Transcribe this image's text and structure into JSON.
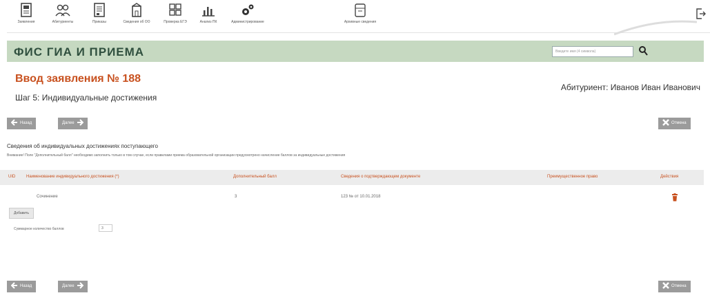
{
  "toolbar": {
    "items": [
      {
        "label": "Заявления",
        "icon": "document-icon"
      },
      {
        "label": "Абитуриенты",
        "icon": "users-icon"
      },
      {
        "label": "Приказы",
        "icon": "order-icon"
      },
      {
        "label": "Сведения об ОО",
        "icon": "building-icon"
      },
      {
        "label": "Проверка ЕГЭ",
        "icon": "grid-check-icon"
      },
      {
        "label": "Анализ ПК",
        "icon": "bar-chart-icon"
      },
      {
        "label": "Администрирование",
        "icon": "gears-icon"
      },
      {
        "label": "Архивные сведения",
        "icon": "archive-icon"
      }
    ]
  },
  "header": {
    "brand": "ФИС ГИА И ПРИЕМА",
    "search_placeholder": "Введите имя (4 символа)"
  },
  "page": {
    "title": "Ввод заявления № 188",
    "step": "Шаг 5: Индивидуальные достижения",
    "applicant": "Абитуриент: Иванов Иван Иванович"
  },
  "nav": {
    "back_label": "Назад",
    "next_label": "Далее",
    "cancel_label": "Отмена"
  },
  "section": {
    "title": "Сведения об индивидуальных достижениях поступающего",
    "note": "Внимание! Поле \"Дополнительный балл\" необходимо заполнить только в том случае, если правилами приема образовательной организации предусмотрено начисление баллов за индивидуальные достижения"
  },
  "table": {
    "headers": [
      "UID",
      "Наименование индивидуального достижения (*)",
      "Дополнительный балл",
      "Сведения о подтверждающем документе",
      "Преимущественное право",
      "Действия"
    ],
    "rows": [
      {
        "uid": "",
        "name": "Сочинение",
        "score": "3",
        "document": "123 № от 10.01.2018",
        "priority": ""
      }
    ]
  },
  "add_label": "Добавить",
  "total": {
    "label": "Суммарное количество баллов",
    "value": "3"
  },
  "colors": {
    "accent": "#c8511f",
    "titlebar": "#c6d9c1",
    "button": "#9b9b9b"
  }
}
